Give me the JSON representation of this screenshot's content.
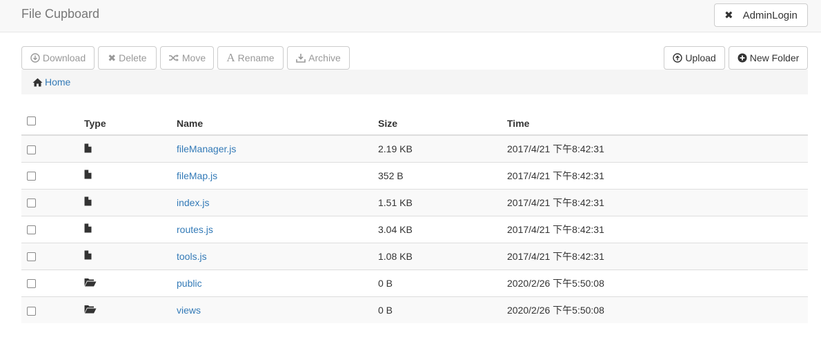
{
  "app": {
    "title": "File Cupboard"
  },
  "header": {
    "admin_button": "AdminLogin"
  },
  "toolbar": {
    "download": "Download",
    "delete": "Delete",
    "move": "Move",
    "rename": "Rename",
    "archive": "Archive",
    "upload": "Upload",
    "new_folder": "New Folder"
  },
  "breadcrumb": {
    "home": "Home"
  },
  "table": {
    "columns": {
      "type": "Type",
      "name": "Name",
      "size": "Size",
      "time": "Time"
    },
    "rows": [
      {
        "type": "file-icon",
        "name": "fileManager.js",
        "size": "2.19 KB",
        "time": "2017/4/21 下午8:42:31"
      },
      {
        "type": "file-icon",
        "name": "fileMap.js",
        "size": "352 B",
        "time": "2017/4/21 下午8:42:31"
      },
      {
        "type": "file-icon",
        "name": "index.js",
        "size": "1.51 KB",
        "time": "2017/4/21 下午8:42:31"
      },
      {
        "type": "file-icon",
        "name": "routes.js",
        "size": "3.04 KB",
        "time": "2017/4/21 下午8:42:31"
      },
      {
        "type": "file-icon",
        "name": "tools.js",
        "size": "1.08 KB",
        "time": "2017/4/21 下午8:42:31"
      },
      {
        "type": "folder-icon",
        "name": "public",
        "size": "0 B",
        "time": "2020/2/26 下午5:50:08"
      },
      {
        "type": "folder-icon",
        "name": "views",
        "size": "0 B",
        "time": "2020/2/26 下午5:50:08"
      }
    ]
  },
  "colors": {
    "link": "#337ab7",
    "disabled_text": "#999999",
    "stripe": "#f9f9f9",
    "navbar_bg": "#f8f8f8"
  }
}
